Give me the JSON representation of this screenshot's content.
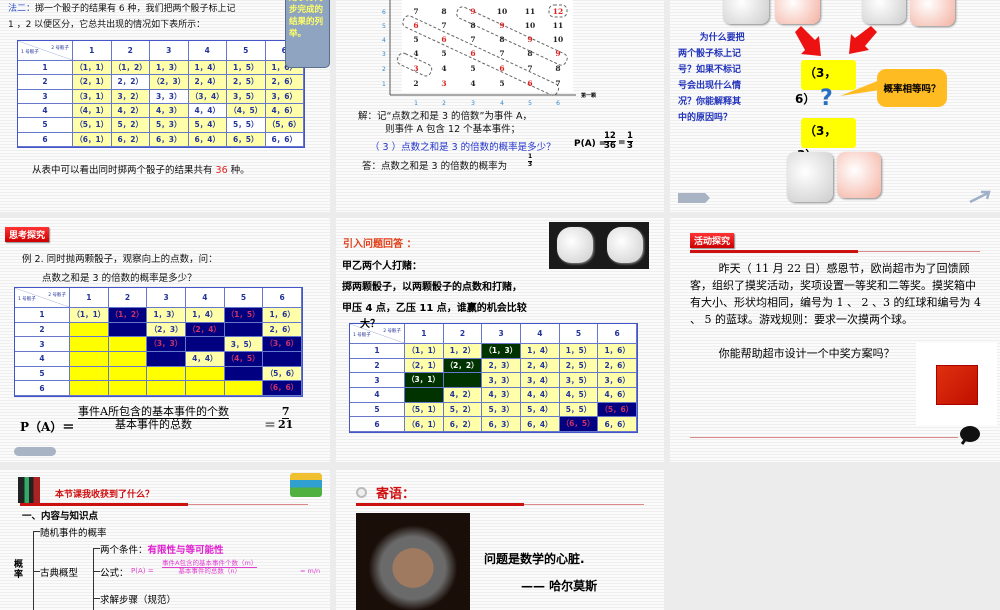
{
  "slide1": {
    "line1_prefix": "法二：",
    "line1": "掷一个骰子的结果有 6 种，我们把两个骰子标上记",
    "line2": "1 ，2 以便区分，它总共出现的情况如下表所示：",
    "callout": "用于分两步完成的结果的列举。",
    "footer_pre": "从表中可以看出同时掷两个骰子的结果共有 ",
    "footer_num": "36",
    "footer_post": " 种。",
    "table": {
      "corner_col": "2 号骰子",
      "corner_row": "1 号骰子",
      "cols": [
        "1",
        "2",
        "3",
        "4",
        "5",
        "6"
      ],
      "rows": [
        "1",
        "2",
        "3",
        "4",
        "5",
        "6"
      ],
      "cells": [
        [
          "（1，1）",
          "（1，2）",
          "1，3）",
          "1，4）",
          "1，5）",
          "1，6）"
        ],
        [
          "（2，1）",
          "2，2）",
          "（2，3）",
          "2，4）",
          "2，5）",
          "2，6）"
        ],
        [
          "（3，1）",
          "3，2）",
          "3，3）",
          "（3，4）",
          "3，5）",
          "3，6）"
        ],
        [
          "（4，1）",
          "4，2）",
          "4，3）",
          "4，4）",
          "（4，5）",
          "4，6）"
        ],
        [
          "（5，1）",
          "5，2）",
          "5，3）",
          "5，4）",
          "5，5）",
          "（5，6）"
        ],
        [
          "（6，1）",
          "6，2）",
          "6，3）",
          "6，4）",
          "6，5）",
          "6，6）"
        ]
      ],
      "highlight": [
        [
          "pale",
          "pale",
          "pale",
          "pale",
          "pale",
          "pale"
        ],
        [
          "pale",
          "white",
          "pale",
          "pale",
          "pale",
          "pale"
        ],
        [
          "pale",
          "pale",
          "white",
          "pale",
          "pale",
          "pale"
        ],
        [
          "pale",
          "pale",
          "pale",
          "white",
          "pale",
          "pale"
        ],
        [
          "pale",
          "pale",
          "pale",
          "pale",
          "white",
          "pale"
        ],
        [
          "pale",
          "pale",
          "pale",
          "pale",
          "pale",
          "white"
        ]
      ]
    }
  },
  "slide2": {
    "grid": [
      [
        7,
        8,
        9,
        10,
        11,
        12
      ],
      [
        6,
        7,
        8,
        9,
        10,
        11
      ],
      [
        5,
        6,
        7,
        8,
        9,
        10
      ],
      [
        4,
        5,
        6,
        7,
        8,
        9
      ],
      [
        3,
        4,
        5,
        6,
        7,
        8
      ],
      [
        2,
        3,
        4,
        5,
        6,
        7
      ]
    ],
    "y_ticks": [
      "6",
      "5",
      "4",
      "3",
      "2",
      "1"
    ],
    "x_ticks": [
      "1",
      "2",
      "3",
      "4",
      "5",
      "6"
    ],
    "x_label": "第一颗",
    "sol1": "解：记“点数之和是 3 的倍数”为事件 A，",
    "sol2": "则事件 A 包含 12 个基本事件；",
    "question": "（ 3 ）点数之和是 3 的倍数的概率是多少？",
    "pa": "P(A) =",
    "f1n": "12",
    "f1d": "36",
    "eq": "=",
    "f2n": "1",
    "f2d": "3",
    "answer": "答：点数之和是 3 的倍数的概率为",
    "ans_n": "1",
    "ans_d": "3"
  },
  "slide3": {
    "side_text": "为什么要把两个骰子标上记号？如果不标记号会出现什么情况？你能解释其中的原因吗？",
    "box1a": "（3，",
    "box1b": "6）",
    "box2a": "（3，",
    "box2b": "3）",
    "q": "?",
    "bubble": "概率相等吗？"
  },
  "slide4": {
    "label": "思考探究",
    "line1": "例 2. 同时抛两颗骰子，观察向上的点数，问：",
    "line2": "点数之和是 3 的倍数的概率是多少？",
    "table": {
      "corner_col": "2 号骰子",
      "corner_row": "1 号骰子",
      "cols": [
        "1",
        "2",
        "3",
        "4",
        "5",
        "6"
      ],
      "rows": [
        "1",
        "2",
        "3",
        "4",
        "5",
        "6"
      ],
      "cells": [
        [
          "（1，1）",
          "（1，2）",
          "1，3）",
          "1，4）",
          "（1，5）",
          "1，6）"
        ],
        [
          "",
          "",
          "（2，3）",
          "（2，4）",
          "",
          "2，6）"
        ],
        [
          "",
          "",
          "（3，3）",
          "",
          "3，5）",
          "（3，6）"
        ],
        [
          "",
          "",
          "",
          "4，4）",
          "（4，5）",
          ""
        ],
        [
          "",
          "",
          "",
          "",
          "",
          "（5，6）"
        ],
        [
          "",
          "",
          "",
          "",
          "",
          "（6，6）"
        ]
      ],
      "highlight": [
        [
          "pale",
          "navy",
          "pale",
          "pale",
          "navy",
          "pale"
        ],
        [
          "yellow",
          "navy",
          "pale",
          "navy",
          "navy",
          "pale"
        ],
        [
          "yellow",
          "yellow",
          "navy",
          "navy",
          "pale",
          "navy"
        ],
        [
          "yellow",
          "yellow",
          "navy",
          "pale",
          "navy",
          "navy"
        ],
        [
          "yellow",
          "yellow",
          "yellow",
          "yellow",
          "navy",
          "pale"
        ],
        [
          "yellow",
          "yellow",
          "yellow",
          "yellow",
          "yellow",
          "navy"
        ]
      ]
    },
    "pa": "P（A）＝",
    "num": "事件A所包含的基本事件的个数",
    "den": "基本事件的总数",
    "eq": "＝",
    "rn": "7",
    "rd": "21"
  },
  "slide5": {
    "title": "引入问题回答 ：",
    "l1": "甲乙两个人打赌：",
    "l2": "掷两颗骰子，以两颗骰子的点数和打赌，",
    "l3": "甲压 4 点，乙压 11 点，谁赢的机会比较",
    "l4": "大？",
    "table": {
      "corner_col": "2 号骰子",
      "corner_row": "1 号骰子",
      "cols": [
        "1",
        "2",
        "3",
        "4",
        "5",
        "6"
      ],
      "rows": [
        "1",
        "2",
        "3",
        "4",
        "5",
        "6"
      ],
      "cells": [
        [
          "（1，1）",
          "1，2）",
          "（1，3）",
          "1，4）",
          "1，5）",
          "1，6）"
        ],
        [
          "（2，1）",
          "（2，2）",
          "2，3）",
          "2，4）",
          "2，5）",
          "2，6）"
        ],
        [
          "（3，1）",
          "",
          "3，3）",
          "3，4）",
          "3，5）",
          "3，6）"
        ],
        [
          "",
          "4，2）",
          "4，3）",
          "4，4）",
          "4，5）",
          "4，6）"
        ],
        [
          "（5，1）",
          "5，2）",
          "5，3）",
          "5，4）",
          "5，5）",
          "（5，6）"
        ],
        [
          "（6，1）",
          "6，2）",
          "6，3）",
          "6，4）",
          "（6，5）",
          "6，6）"
        ]
      ],
      "highlight": [
        [
          "pale",
          "pale",
          "green",
          "pale",
          "pale",
          "pale"
        ],
        [
          "pale",
          "green",
          "pale",
          "pale",
          "pale",
          "pale"
        ],
        [
          "green",
          "green",
          "pale",
          "pale",
          "pale",
          "pale"
        ],
        [
          "green",
          "pale",
          "pale",
          "pale",
          "pale",
          "pale"
        ],
        [
          "pale",
          "pale",
          "pale",
          "pale",
          "pale",
          "navy"
        ],
        [
          "pale",
          "pale",
          "pale",
          "pale",
          "navy",
          "pale"
        ]
      ]
    }
  },
  "slide6": {
    "label": "活动探究",
    "para": "昨天（ 11 月 22 日）感恩节，欧尚超市为了回馈顾客，组织了摸奖活动，奖项设置一等奖和二等奖。摸奖箱中有大小、形状均相同，编号为 1 、 2 、3 的红球和编号为 4 、 5 的蓝球。游戏规则：要求一次摸两个球。",
    "para2": "你能帮助超市设计一个中奖方案吗？"
  },
  "slide7": {
    "title": "本节课我收获到了什么？",
    "h1": "一、内容与知识点",
    "n1": "随机事件的概率",
    "root": "概率",
    "n2": "古典概型",
    "c1": "两个条件：",
    "c1v": "有限性与等可能性",
    "c2": "公式：",
    "c2pa": "P(A) =",
    "c2n": "事件A包含的基本事件个数（m）",
    "c2d": "基本事件的总数（n）",
    "c2r": "= m/n",
    "c3": "求解步骤（规范）"
  },
  "slide8": {
    "title": "寄语：",
    "quote": "问题是数学的心脏.",
    "author": "—— 哈尔莫斯"
  }
}
